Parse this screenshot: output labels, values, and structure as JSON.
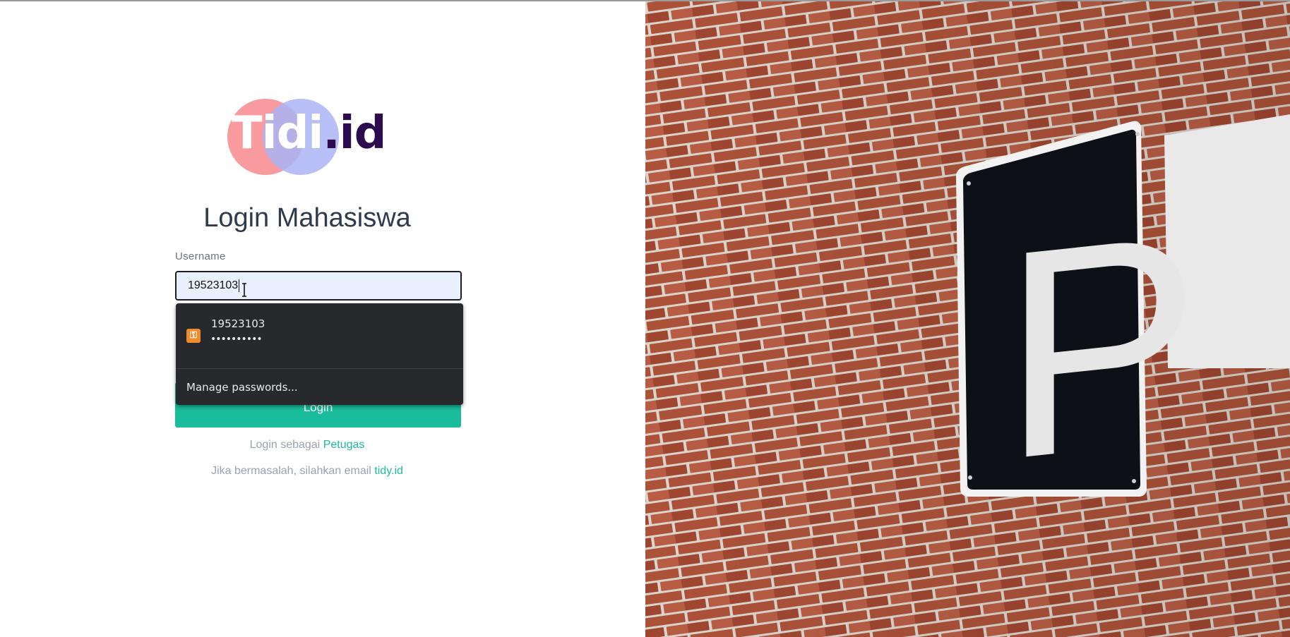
{
  "logo": {
    "main": "Tidi",
    "suffix": ".id"
  },
  "title": "Login Mahasiswa",
  "username": {
    "label": "Username",
    "value": "19523103"
  },
  "autofill": {
    "username": "19523103",
    "password_mask": "••••••••••",
    "manage_label": "Manage passwords..."
  },
  "login_button": "Login",
  "alt_login": {
    "prefix": "Login sebagai ",
    "link": "Petugas"
  },
  "help": {
    "prefix": "Jika bermasalah, silahkan email ",
    "link": "tidy.id"
  },
  "sign": {
    "letter": "P"
  },
  "colors": {
    "accent": "#1abc9c",
    "dropdown_bg": "#28292d",
    "input_bg": "#e8f0fe"
  }
}
